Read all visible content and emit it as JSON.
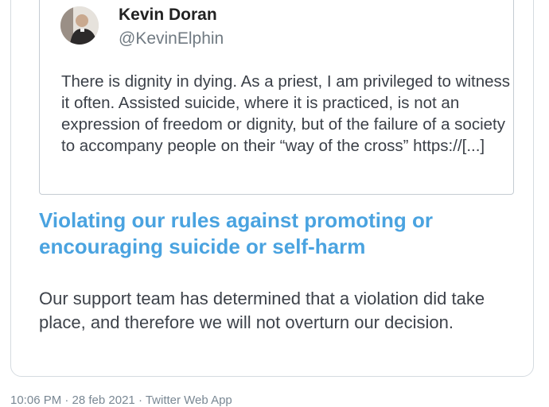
{
  "quoted_tweet": {
    "author_name": "Kevin Doran",
    "author_handle": "@KevinElphin",
    "text": "There is dignity in dying. As a priest, I am privileged to witness it often. Assisted suicide, where it is practiced, is not an expression of freedom or dignity, but of the failure of a society to accompany people on their “way of the cross” https://[...]",
    "avatar_icon": "profile-photo"
  },
  "notice": {
    "heading": "Violating our rules against promoting or encouraging suicide or self-harm",
    "body": "Our support team has determined that a violation did take place, and therefore we will not overturn our decision."
  },
  "footer": {
    "meta": "10:06 PM · 28 feb 2021 · Twitter Web App"
  },
  "colors": {
    "heading_blue": "#4aa3e0",
    "border": "#d5dbe0",
    "handle_gray": "#707a82"
  }
}
